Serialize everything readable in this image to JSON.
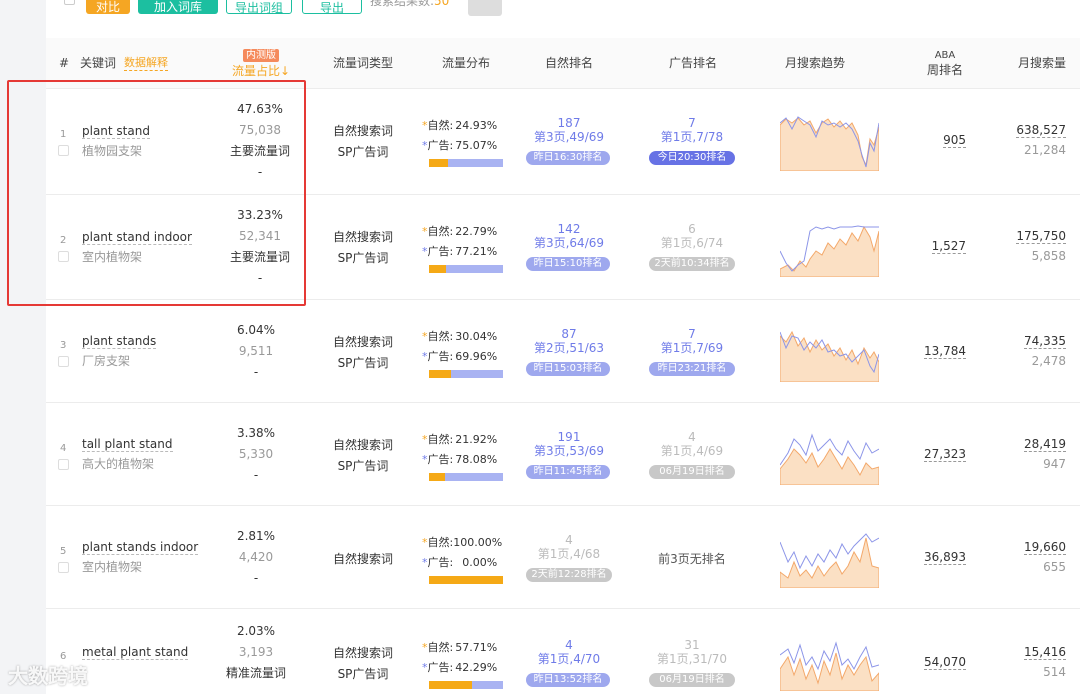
{
  "toolbar": {
    "btn1": "对比",
    "btn2": "加入词库",
    "btn3": "导出词组",
    "btn4": "导出",
    "result_label": "搜索结果数:",
    "result_count": "50"
  },
  "header": {
    "hash": "#",
    "keyword": "关键词",
    "data_explain": "数据解释",
    "beta_badge": "内测版",
    "share": "流量占比↓",
    "type": "流量词类型",
    "dist": "流量分布",
    "natural_rank": "自然排名",
    "ad_rank": "广告排名",
    "trend": "月搜索趋势",
    "aba_1": "ABA",
    "aba_2": "周排名",
    "monthly": "月搜索量"
  },
  "rows": [
    {
      "idx": "1",
      "kw": "plant stand",
      "kw_cn": "植物园支架",
      "pct": "47.63%",
      "num": "75,038",
      "tag": "主要流量词",
      "dash": "-",
      "type1": "自然搜索词",
      "type2": "SP广告词",
      "nat_label": "自然:",
      "nat": "24.93%",
      "ad_label": "广告:",
      "ad": "75.07%",
      "nat_frac": 0.25,
      "nr_n": "187",
      "nr_p": "第3页,49/69",
      "nr_pill": "昨日16:30排名",
      "ar_n": "7",
      "ar_p": "第1页,7/78",
      "ar_pill": "今日20:30排名",
      "ar_style": "dark",
      "aba": "905",
      "m1": "638,527",
      "m2": "21,284"
    },
    {
      "idx": "2",
      "kw": "plant stand indoor",
      "kw_cn": "室内植物架",
      "pct": "33.23%",
      "num": "52,341",
      "tag": "主要流量词",
      "dash": "-",
      "type1": "自然搜索词",
      "type2": "SP广告词",
      "nat_label": "自然:",
      "nat": "22.79%",
      "ad_label": "广告:",
      "ad": "77.21%",
      "nat_frac": 0.23,
      "nr_n": "142",
      "nr_p": "第3页,64/69",
      "nr_pill": "昨日15:10排名",
      "ar_n": "6",
      "ar_p": "第1页,6/74",
      "ar_pill": "2天前10:34排名",
      "ar_style": "grey",
      "aba": "1,527",
      "m1": "175,750",
      "m2": "5,858"
    },
    {
      "idx": "3",
      "kw": "plant stands",
      "kw_cn": "厂房支架",
      "pct": "6.04%",
      "num": "9,511",
      "tag": "",
      "dash": "-",
      "type1": "自然搜索词",
      "type2": "SP广告词",
      "nat_label": "自然:",
      "nat": "30.04%",
      "ad_label": "广告:",
      "ad": "69.96%",
      "nat_frac": 0.3,
      "nr_n": "87",
      "nr_p": "第2页,51/63",
      "nr_pill": "昨日15:03排名",
      "ar_n": "7",
      "ar_p": "第1页,7/69",
      "ar_pill": "昨日23:21排名",
      "ar_style": "light",
      "aba": "13,784",
      "m1": "74,335",
      "m2": "2,478"
    },
    {
      "idx": "4",
      "kw": "tall plant stand",
      "kw_cn": "高大的植物架",
      "pct": "3.38%",
      "num": "5,330",
      "tag": "",
      "dash": "-",
      "type1": "自然搜索词",
      "type2": "SP广告词",
      "nat_label": "自然:",
      "nat": "21.92%",
      "ad_label": "广告:",
      "ad": "78.08%",
      "nat_frac": 0.22,
      "nr_n": "191",
      "nr_p": "第3页,53/69",
      "nr_pill": "昨日11:45排名",
      "ar_n": "4",
      "ar_p": "第1页,4/69",
      "ar_pill": "06月19日排名",
      "ar_style": "grey",
      "aba": "27,323",
      "m1": "28,419",
      "m2": "947"
    },
    {
      "idx": "5",
      "kw": "plant stands indoor",
      "kw_cn": "室内植物架",
      "pct": "2.81%",
      "num": "4,420",
      "tag": "",
      "dash": "-",
      "type1": "自然搜索词",
      "type2": "",
      "nat_label": "自然:",
      "nat": "100.00%",
      "ad_label": "广告:",
      "ad": "0.00%",
      "nat_frac": 1.0,
      "nr_n": "4",
      "nr_p": "第1页,4/68",
      "nr_pill": "2天前12:28排名",
      "nr_gray": true,
      "ar_none": "前3页无排名",
      "aba": "36,893",
      "m1": "19,660",
      "m2": "655"
    },
    {
      "idx": "6",
      "kw": "metal plant stand",
      "kw_cn": "",
      "pct": "2.03%",
      "num": "3,193",
      "tag": "精准流量词",
      "dash": "",
      "type1": "自然搜索词",
      "type2": "SP广告词",
      "nat_label": "自然:",
      "nat": "57.71%",
      "ad_label": "广告:",
      "ad": "42.29%",
      "nat_frac": 0.58,
      "nr_n": "4",
      "nr_p": "第1页,4/70",
      "nr_pill": "昨日13:52排名",
      "ar_n": "31",
      "ar_p": "第1页,31/70",
      "ar_pill": "06月19日排名",
      "ar_style": "grey",
      "aba": "54,070",
      "m1": "15,416",
      "m2": "514"
    }
  ],
  "watermark": "大数跨境",
  "colors": {
    "accent_orange": "#f5a916",
    "accent_purple": "#6f7be8",
    "teal": "#1cbfa0",
    "highlight_red": "#e53935"
  }
}
